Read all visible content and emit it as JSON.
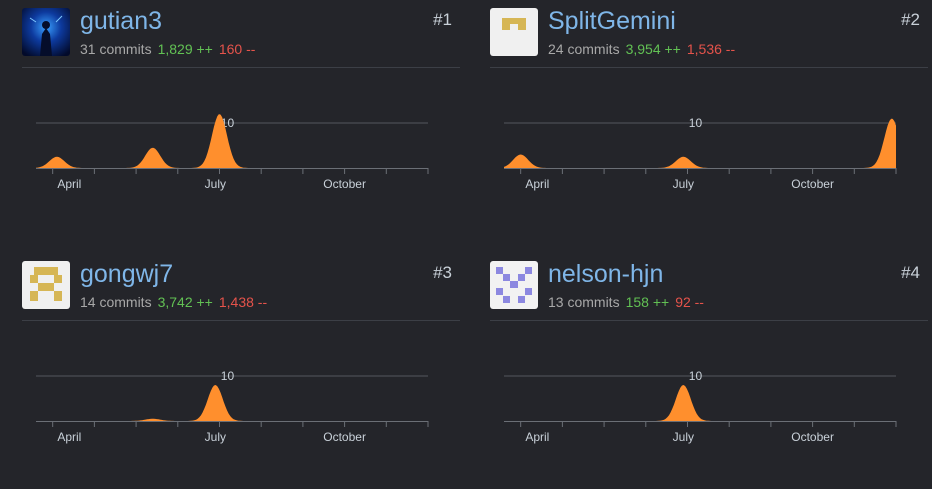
{
  "chart_common": {
    "ytick_label": "10",
    "months": [
      "April",
      "July",
      "October"
    ],
    "fill": "#ff8f2d",
    "grid": "#55585f"
  },
  "contributors": [
    {
      "rank": "#1",
      "username": "gutian3",
      "commits": "31 commits",
      "additions": "1,829 ++",
      "deletions": "160 --",
      "avatar": "dark-blue-photo",
      "chart_data": {
        "type": "area",
        "xlabel": "",
        "ylabel": "",
        "ylim": [
          0,
          14
        ],
        "peaks": [
          {
            "month": 3.1,
            "value": 2.5
          },
          {
            "month": 5.4,
            "value": 4.5
          },
          {
            "month": 7.0,
            "value": 12
          }
        ]
      }
    },
    {
      "rank": "#2",
      "username": "SplitGemini",
      "commits": "24 commits",
      "additions": "3,954 ++",
      "deletions": "1,536 --",
      "avatar": "yellow-identicon",
      "chart_data": {
        "type": "area",
        "xlabel": "",
        "ylabel": "",
        "ylim": [
          0,
          14
        ],
        "peaks": [
          {
            "month": 3.0,
            "value": 3.0
          },
          {
            "month": 6.9,
            "value": 2.5
          },
          {
            "month": 11.9,
            "value": 11
          }
        ]
      }
    },
    {
      "rank": "#3",
      "username": "gongwj7",
      "commits": "14 commits",
      "additions": "3,742 ++",
      "deletions": "1,438 --",
      "avatar": "yellow-identicon",
      "chart_data": {
        "type": "area",
        "xlabel": "",
        "ylabel": "",
        "ylim": [
          0,
          14
        ],
        "peaks": [
          {
            "month": 5.4,
            "value": 0.5
          },
          {
            "month": 6.9,
            "value": 8
          }
        ]
      }
    },
    {
      "rank": "#4",
      "username": "nelson-hjn",
      "commits": "13 commits",
      "additions": "158 ++",
      "deletions": "92 --",
      "avatar": "purple-identicon",
      "chart_data": {
        "type": "area",
        "xlabel": "",
        "ylabel": "",
        "ylim": [
          0,
          14
        ],
        "peaks": [
          {
            "month": 6.9,
            "value": 8
          }
        ]
      }
    }
  ]
}
